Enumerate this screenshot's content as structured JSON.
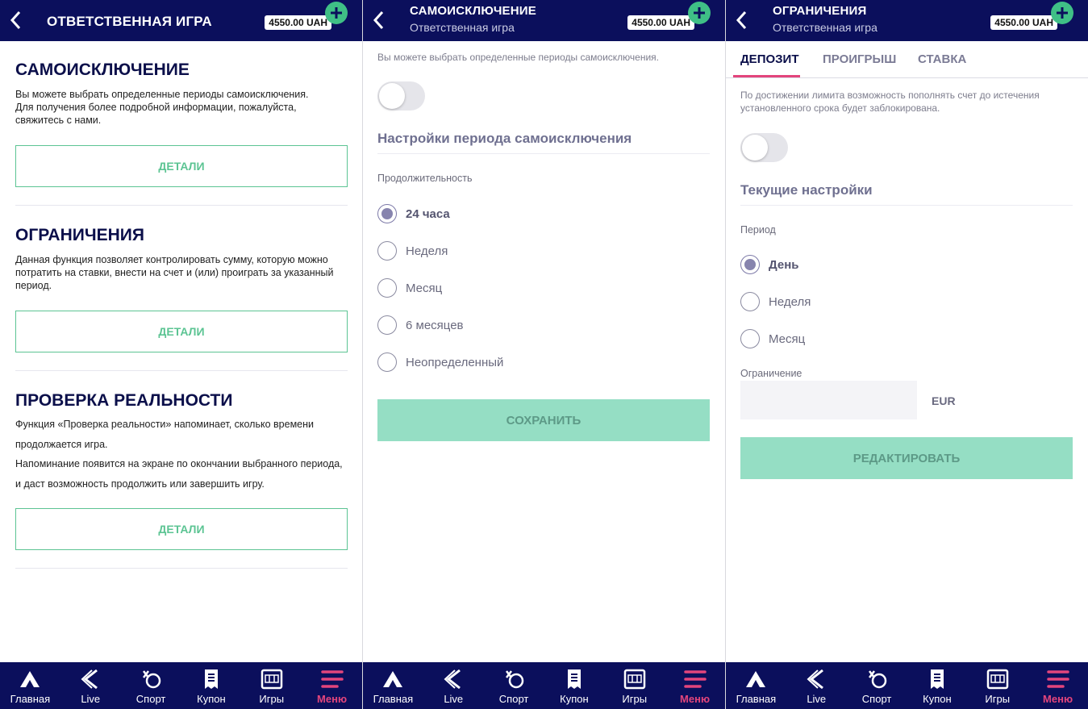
{
  "balance": "4550.00 UAH",
  "colors": {
    "header": "#0b0f5c",
    "accent": "#5cc493",
    "active": "#e3457c"
  },
  "panel1": {
    "title": "ОТВЕТСТВЕННАЯ ИГРА",
    "sections": [
      {
        "title": "САМОИСКЛЮЧЕНИЕ",
        "text": "Вы можете выбрать определенные периоды самоисключения.\nДля получения более подробной информации, пожалуйста, свяжитесь с нами.",
        "button": "ДЕТАЛИ"
      },
      {
        "title": "ОГРАНИЧЕНИЯ",
        "text": "Данная функция позволяет контролировать сумму, которую можно потратить на ставки, внести на счет и (или) проиграть за указанный период.",
        "button": "ДЕТАЛИ"
      },
      {
        "title": "ПРОВЕРКА РЕАЛЬНОСТИ",
        "text": "Функция «Проверка реальности» напоминает, сколько времени продолжается игра.\nНапоминание появится на экране по окончании выбранного периода, и даст возможность продолжить или завершить игру.",
        "button": "ДЕТАЛИ"
      }
    ]
  },
  "panel2": {
    "title": "САМОИСКЛЮЧЕНИЕ",
    "subtitle": "Ответственная игра",
    "intro": "Вы можете выбрать определенные периоды самоисключения.",
    "settings_heading": "Настройки периода самоисключения",
    "duration_label": "Продолжительность",
    "options": [
      "24 часа",
      "Неделя",
      "Месяц",
      "6 месяцев",
      "Неопределенный"
    ],
    "selected": 0,
    "save": "СОХРАНИТЬ"
  },
  "panel3": {
    "title": "ОГРАНИЧЕНИЯ",
    "subtitle": "Ответственная игра",
    "tabs": [
      "ДЕПОЗИТ",
      "ПРОИГРЫШ",
      "СТАВКА"
    ],
    "active_tab": 0,
    "info": "По достижении лимита возможность пополнять счет до истечения установленного срока будет заблокирована.",
    "current_heading": "Текущие настройки",
    "period_label": "Период",
    "options": [
      "День",
      "Неделя",
      "Месяц"
    ],
    "selected": 0,
    "limit_label": "Ограничение",
    "limit_value": "",
    "currency": "EUR",
    "edit": "РЕДАКТИРОВАТЬ"
  },
  "nav": [
    {
      "label": "Главная",
      "icon": "home-icon"
    },
    {
      "label": "Live",
      "icon": "live-icon"
    },
    {
      "label": "Спорт",
      "icon": "sport-icon"
    },
    {
      "label": "Купон",
      "icon": "coupon-icon"
    },
    {
      "label": "Игры",
      "icon": "games-icon"
    },
    {
      "label": "Меню",
      "icon": "menu-icon",
      "active": true
    }
  ]
}
